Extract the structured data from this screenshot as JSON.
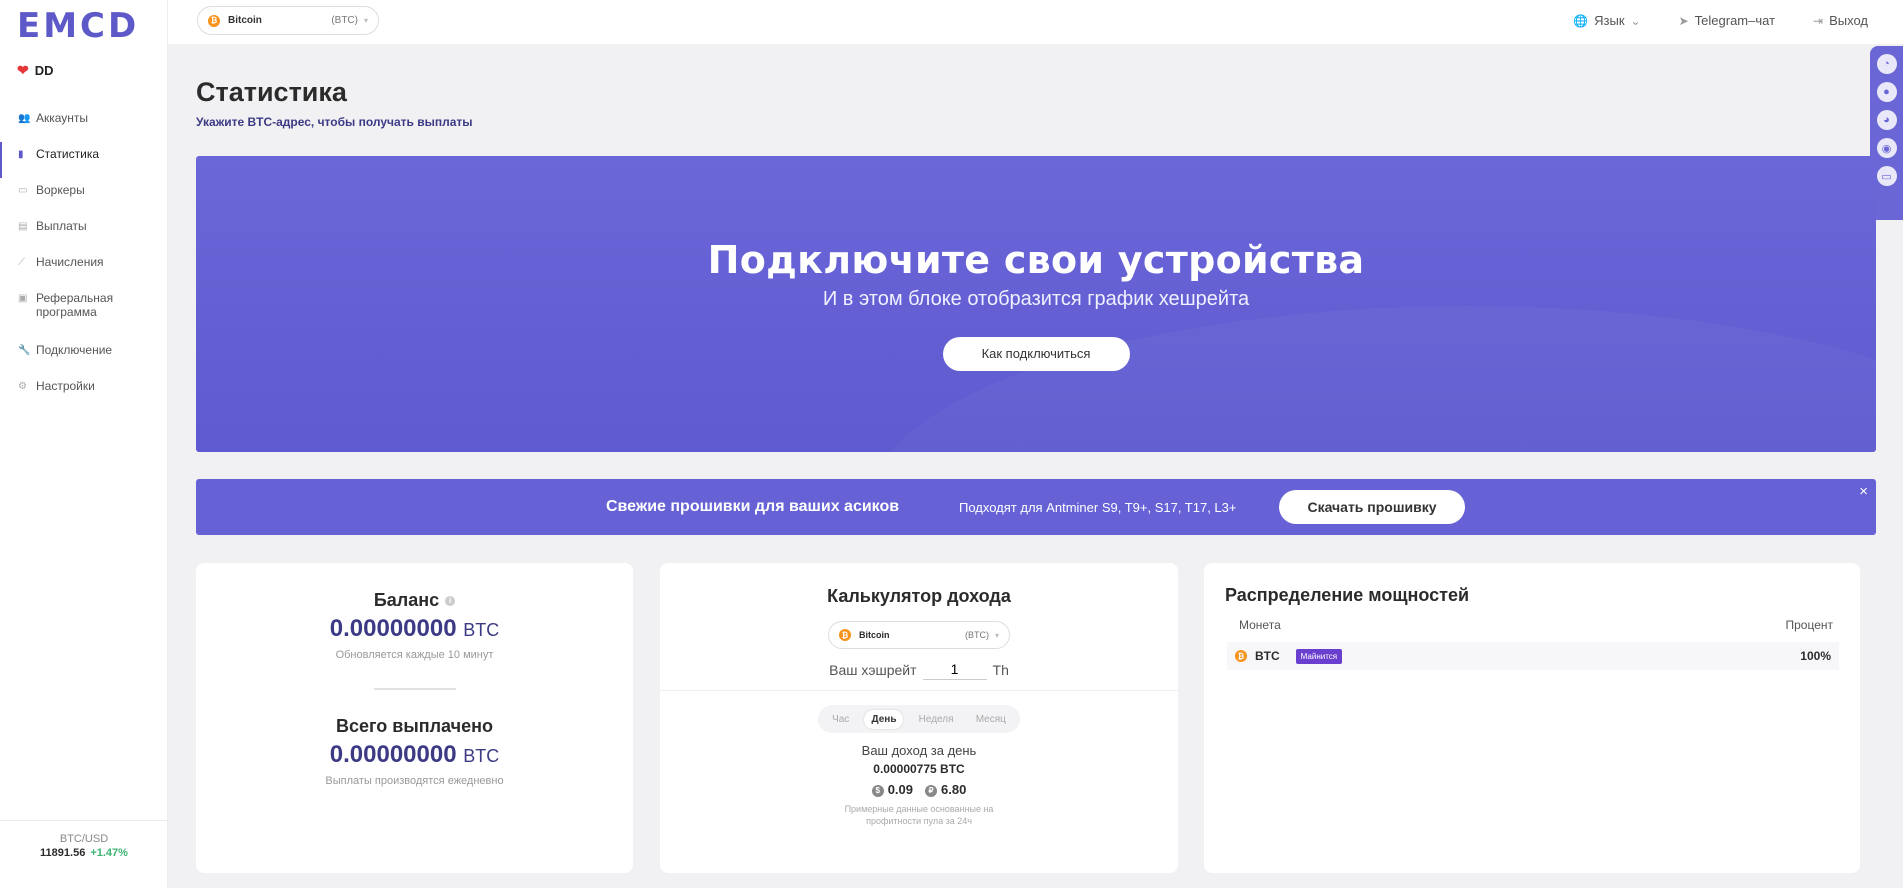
{
  "brand": {
    "logo": "EMCD"
  },
  "user": {
    "name": "DD"
  },
  "sidebar": {
    "items": [
      {
        "label": "Аккаунты",
        "icon": "users-icon"
      },
      {
        "label": "Статистика",
        "icon": "bar-chart-icon"
      },
      {
        "label": "Воркеры",
        "icon": "monitor-icon"
      },
      {
        "label": "Выплаты",
        "icon": "list-icon"
      },
      {
        "label": "Начисления",
        "icon": "trend-icon"
      },
      {
        "label": "Реферальная программа",
        "icon": "doc-icon"
      },
      {
        "label": "Подключение",
        "icon": "wrench-icon"
      },
      {
        "label": "Настройки",
        "icon": "gear-icon"
      }
    ],
    "rate": {
      "pair": "BTC/USD",
      "value": "11891.56",
      "change": "+1.47%"
    }
  },
  "topbar": {
    "coin": {
      "name": "Bitcoin",
      "ticker": "(BTC)"
    },
    "language": "Язык",
    "telegram": "Telegram–чат",
    "logout": "Выход"
  },
  "page": {
    "title": "Статистика",
    "subtitle": "Укажите BTC-адрес, чтобы получать выплаты"
  },
  "hero": {
    "title": "Подключите свои устройства",
    "subtitle": "И в этом блоке отобразится график хешрейта",
    "button": "Как подключиться"
  },
  "banner": {
    "title": "Свежие прошивки для ваших асиков",
    "subtitle": "Подходят для Antminer S9, T9+, S17, T17, L3+",
    "button": "Скачать прошивку",
    "close": "×"
  },
  "balance": {
    "title": "Баланс",
    "value": "0.00000000",
    "unit": "BTC",
    "note": "Обновляется каждые 10 минут",
    "paid_title": "Всего выплачено",
    "paid_value": "0.00000000",
    "paid_unit": "BTC",
    "paid_note": "Выплаты производятся ежедневно"
  },
  "calculator": {
    "title": "Калькулятор дохода",
    "coin": {
      "name": "Bitcoin",
      "ticker": "(BTC)"
    },
    "hashrate_label": "Ваш хэшрейт",
    "hashrate_value": "1",
    "hashrate_unit": "Th",
    "periods": [
      "Час",
      "День",
      "Неделя",
      "Месяц"
    ],
    "active_period": "День",
    "income_title": "Ваш доход за день",
    "income_value": "0.00000775 BTC",
    "usd": "0.09",
    "rub": "6.80",
    "disclaimer": "Примерные данные основанные на профитности пула за 24ч"
  },
  "distribution": {
    "title": "Распределение мощностей",
    "col_coin": "Монета",
    "col_pct": "Процент",
    "rows": [
      {
        "coin": "BTC",
        "badge": "Майнится",
        "pct": "100%"
      }
    ]
  },
  "colors": {
    "accent": "#5d59c9",
    "hero": "#6661d5",
    "positive": "#3cb371",
    "btc": "#f7931a"
  }
}
